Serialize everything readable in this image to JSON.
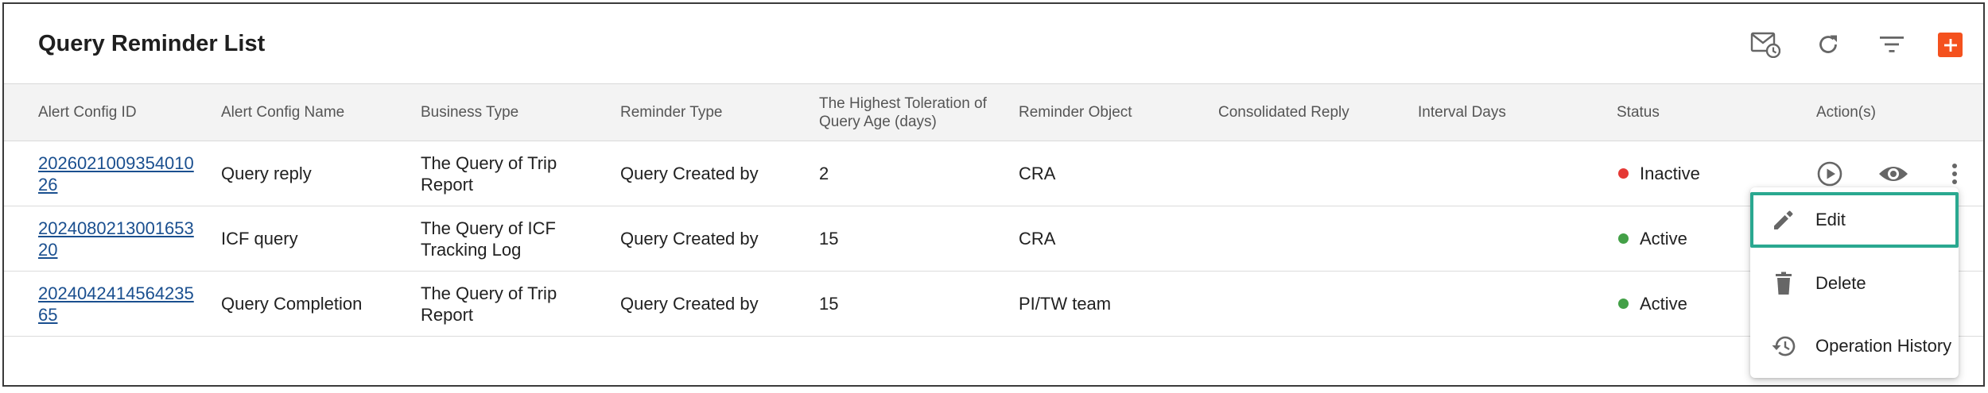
{
  "page": {
    "title": "Query Reminder List"
  },
  "toolbar": {
    "icons": [
      "mail-schedule-icon",
      "refresh-icon",
      "filter-icon",
      "add-icon"
    ],
    "accent": "#f4511e"
  },
  "table": {
    "columns": [
      "Alert Config ID",
      "Alert Config Name",
      "Business Type",
      "Reminder Type",
      "The Highest Toleration of Query Age (days)",
      "Reminder Object",
      "Consolidated Reply",
      "Interval Days",
      "Status",
      "Action(s)"
    ],
    "rows": [
      {
        "id": "202602100935401026",
        "name": "Query reply",
        "business_type": "The Query of Trip Report",
        "reminder_type": "Query Created by",
        "highest_toleration": "2",
        "reminder_object": "CRA",
        "consolidated_reply": "",
        "interval_days": "",
        "status": "Inactive",
        "status_color": "#e53935"
      },
      {
        "id": "202408021300165320",
        "name": "ICF query",
        "business_type": "The Query of ICF Tracking Log",
        "reminder_type": "Query Created by",
        "highest_toleration": "15",
        "reminder_object": "CRA",
        "consolidated_reply": "",
        "interval_days": "",
        "status": "Active",
        "status_color": "#43a047"
      },
      {
        "id": "202404241456423565",
        "name": "Query Completion",
        "business_type": "The Query of Trip Report",
        "reminder_type": "Query Created by",
        "highest_toleration": "15",
        "reminder_object": "PI/TW team",
        "consolidated_reply": "",
        "interval_days": "",
        "status": "Active",
        "status_color": "#43a047"
      }
    ],
    "row_actions": [
      "play-icon",
      "eye-icon",
      "more-vert-icon"
    ]
  },
  "menu": {
    "items": [
      {
        "label": "Edit",
        "icon": "pencil-icon"
      },
      {
        "label": "Delete",
        "icon": "trash-icon"
      },
      {
        "label": "Operation History",
        "icon": "history-icon"
      }
    ],
    "highlight_color": "#2aa890"
  }
}
